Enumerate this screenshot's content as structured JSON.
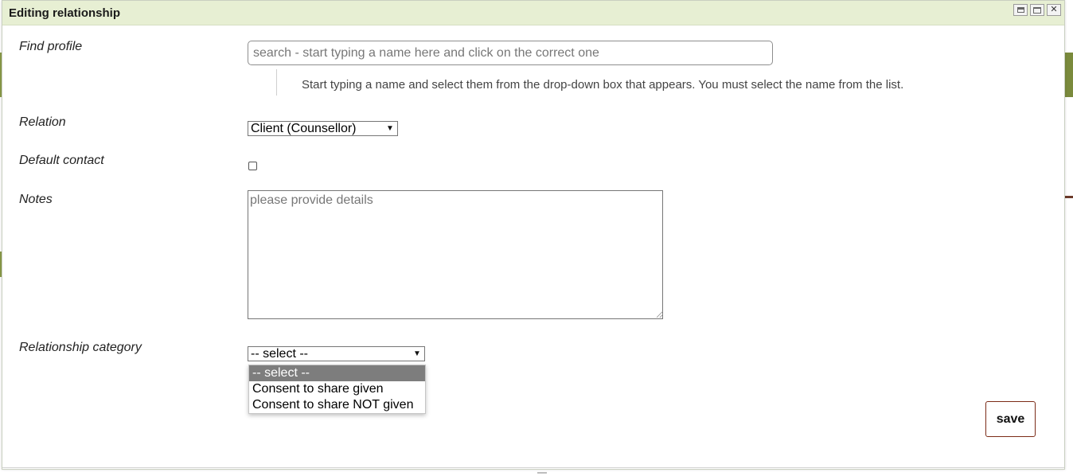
{
  "dialog": {
    "title": "Editing relationship",
    "buttons": {
      "print_icon": "print-icon",
      "maximize_icon": "maximize-icon",
      "close_label": "✕"
    }
  },
  "form": {
    "find_profile": {
      "label": "Find profile",
      "placeholder": "search - start typing a name here and click on the correct one",
      "hint": "Start typing a name and select them from the drop-down box that appears. You must select the name from the list."
    },
    "relation": {
      "label": "Relation",
      "selected": "Client (Counsellor)"
    },
    "default_contact": {
      "label": "Default contact",
      "checked": false
    },
    "notes": {
      "label": "Notes",
      "placeholder": "please provide details"
    },
    "relationship_category": {
      "label": "Relationship category",
      "selected": "-- select --",
      "options": [
        "-- select --",
        "Consent to share given",
        "Consent to share NOT given"
      ]
    },
    "save_label": "save"
  },
  "colors": {
    "titlebar_bg": "#e7efd3",
    "save_border": "#7b2b17",
    "option_highlight": "#7d7d7d"
  }
}
